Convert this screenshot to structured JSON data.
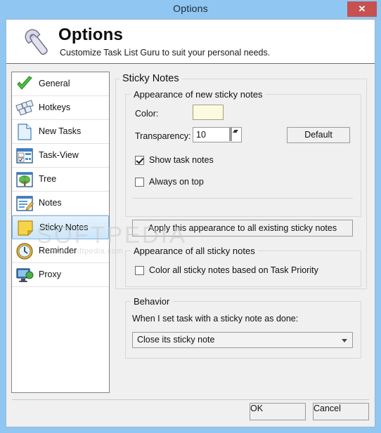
{
  "window": {
    "title": "Options",
    "close_label": "✕",
    "titlebar_color": "#8fc7f2"
  },
  "header": {
    "icon": "wrench-icon",
    "title": "Options",
    "subtitle": "Customize Task List Guru to suit your personal needs."
  },
  "sidebar": {
    "items": [
      {
        "label": "General",
        "icon": "green-check-icon",
        "selected": false
      },
      {
        "label": "Hotkeys",
        "icon": "keyboard-keys-icon",
        "selected": false
      },
      {
        "label": "New Tasks",
        "icon": "document-icon",
        "selected": false
      },
      {
        "label": "Task-View",
        "icon": "task-view-icon",
        "selected": false
      },
      {
        "label": "Tree",
        "icon": "tree-icon",
        "selected": false
      },
      {
        "label": "Notes",
        "icon": "notes-pencil-icon",
        "selected": false
      },
      {
        "label": "Sticky Notes",
        "icon": "sticky-note-icon",
        "selected": true
      },
      {
        "label": "Reminder",
        "icon": "clock-icon",
        "selected": false
      },
      {
        "label": "Proxy",
        "icon": "monitor-icon",
        "selected": false
      }
    ]
  },
  "main": {
    "page_title": "Sticky Notes",
    "new_notes_group": {
      "title": "Appearance of new sticky notes",
      "color_label": "Color:",
      "color_value": "#fcfbe0",
      "transparency_label": "Transparency:",
      "transparency_value": "10",
      "default_button": "Default",
      "show_task_notes": {
        "label": "Show task notes",
        "checked": true
      },
      "always_on_top": {
        "label": "Always on top",
        "checked": false
      },
      "apply_button": "Apply this appearance to all existing sticky notes"
    },
    "all_notes_group": {
      "title": "Appearance of all sticky notes",
      "color_by_priority": {
        "label": "Color all sticky notes based on Task Priority",
        "checked": false
      }
    },
    "behavior_group": {
      "title": "Behavior",
      "prompt": "When I set task with a sticky note as done:",
      "selected_option": "Close its sticky note"
    }
  },
  "footer": {
    "ok_label": "OK",
    "cancel_label": "Cancel"
  },
  "watermark": {
    "main": "SOFTPEDIA",
    "sub": "www.softpedia.com"
  }
}
